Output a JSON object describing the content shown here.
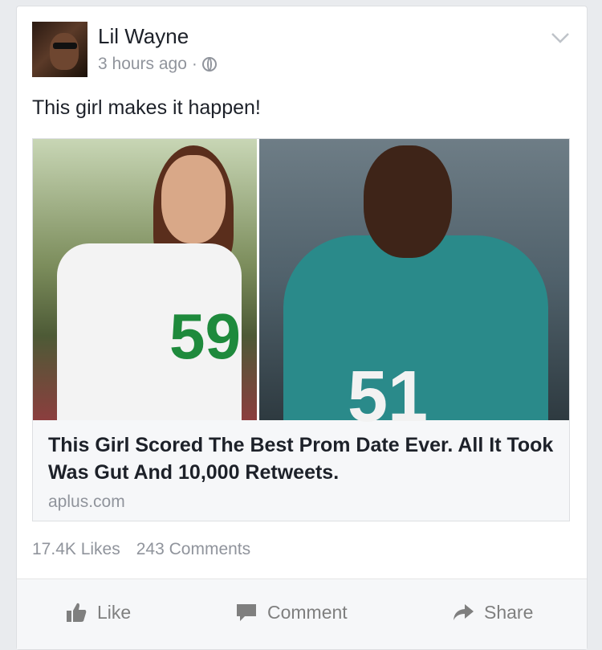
{
  "post": {
    "author": "Lil Wayne",
    "time": "3 hours ago",
    "separator": "·",
    "text": "This girl makes it happen!"
  },
  "link": {
    "title": "This Girl Scored The Best Prom Date Ever. All It Took Was Gut And 10,000 Retweets.",
    "domain": "aplus.com"
  },
  "stats": {
    "likes": "17.4K Likes",
    "comments": "243 Comments"
  },
  "actions": {
    "like": "Like",
    "comment": "Comment",
    "share": "Share"
  },
  "image_text": {
    "left_number": "59",
    "right_number": "51"
  },
  "icons": {
    "menu": "chevron-down-icon",
    "privacy": "globe-icon",
    "like": "thumbs-up-icon",
    "comment": "speech-bubble-icon",
    "share": "share-arrow-icon"
  }
}
